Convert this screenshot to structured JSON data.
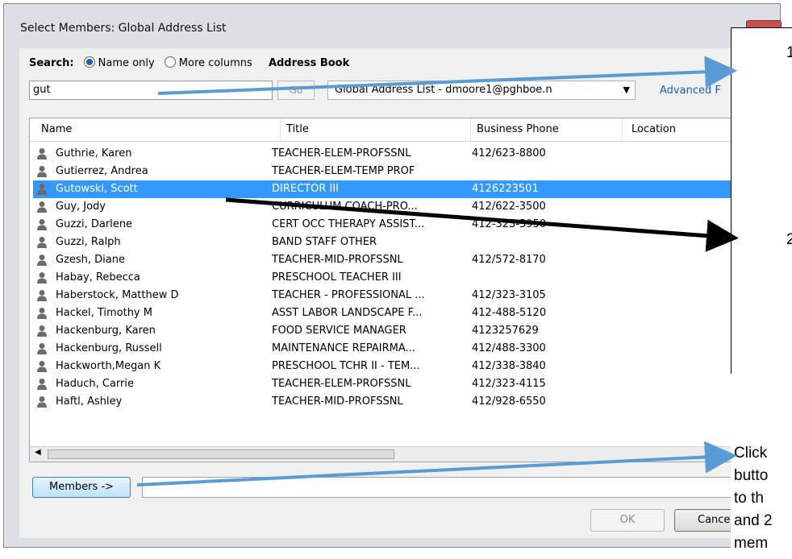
{
  "window": {
    "title": "Select Members: Global Address List"
  },
  "search": {
    "label": "Search:",
    "option_name_only": "Name only",
    "option_more_columns": "More columns",
    "address_book_label": "Address Book",
    "query": "gut",
    "go_label": "Go",
    "address_book_value": "Global Address List - dmoore1@pghboe.n",
    "advanced_label": "Advanced F"
  },
  "table": {
    "columns": [
      "Name",
      "Title",
      "Business Phone",
      "Location"
    ],
    "rows": [
      {
        "name": "Guthrie, Karen",
        "title": "TEACHER-ELEM-PROFSSNL",
        "phone": "412/623-8800"
      },
      {
        "name": "Gutierrez, Andrea",
        "title": "TEACHER-ELEM-TEMP PROF",
        "phone": ""
      },
      {
        "name": "Gutowski, Scott",
        "title": "DIRECTOR III",
        "phone": "4126223501",
        "selected": true
      },
      {
        "name": "Guy, Jody",
        "title": "CURRICULUM COACH-PRO...",
        "phone": "412/622-3500"
      },
      {
        "name": "Guzzi, Darlene",
        "title": "CERT OCC THERAPY ASSIST...",
        "phone": "412-323-3950"
      },
      {
        "name": "Guzzi, Ralph",
        "title": "BAND STAFF OTHER",
        "phone": ""
      },
      {
        "name": "Gzesh, Diane",
        "title": "TEACHER-MID-PROFSSNL",
        "phone": "412/572-8170"
      },
      {
        "name": "Habay, Rebecca",
        "title": "PRESCHOOL TEACHER III",
        "phone": ""
      },
      {
        "name": "Haberstock, Matthew D",
        "title": "TEACHER - PROFESSIONAL ...",
        "phone": "412/323-3105"
      },
      {
        "name": "Hackel, Timothy M",
        "title": "ASST LABOR LANDSCAPE F...",
        "phone": "412-488-5120"
      },
      {
        "name": "Hackenburg, Karen",
        "title": "FOOD SERVICE MANAGER",
        "phone": "4123257629"
      },
      {
        "name": "Hackenburg, Russell",
        "title": "MAINTENANCE REPAIRMA...",
        "phone": "412/488-3300"
      },
      {
        "name": "Hackworth,Megan K",
        "title": "PRESCHOOL TCHR II - TEM...",
        "phone": "412/338-3840"
      },
      {
        "name": "Haduch, Carrie",
        "title": "TEACHER-ELEM-PROFSSNL",
        "phone": "412/323-4115"
      },
      {
        "name": "Haftl, Ashley",
        "title": "TEACHER-MID-PROFSSNL",
        "phone": "412/928-6550"
      }
    ]
  },
  "buttons": {
    "members": "Members ->",
    "ok": "OK",
    "cancel": "Cancel"
  },
  "annotations": {
    "step1": "1",
    "step2": "2",
    "note_lines": [
      "Click",
      "butto",
      "to th",
      "and 2",
      "mem"
    ]
  },
  "colors": {
    "selection": "#3399ff",
    "arrow_blue": "#5b9bd5",
    "arrow_black": "#000000"
  }
}
